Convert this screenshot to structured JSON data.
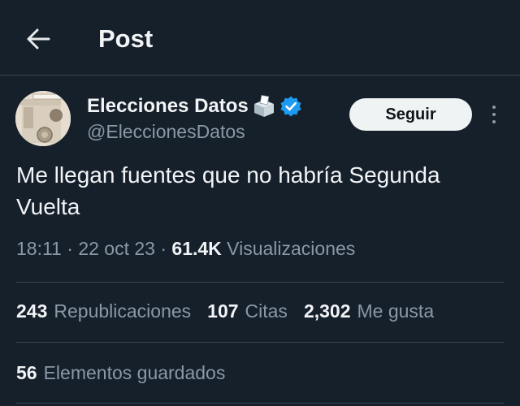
{
  "header": {
    "title": "Post",
    "back_icon": "arrow-left-icon"
  },
  "author": {
    "display_name": "Elecciones Datos",
    "name_emoji": "ballot-box-icon",
    "verified_icon": "verified-badge-icon",
    "handle": "@EleccionesDatos",
    "follow_label": "Seguir",
    "more_icon": "more-vertical-icon"
  },
  "tweet": {
    "text_line1": "Me llegan fuentes que no habría Segunda",
    "text_line2": "Vuelta"
  },
  "meta": {
    "time": "18:11",
    "separator": "·",
    "date": "22 oct 23",
    "views_count": "61.4K",
    "views_label": "Visualizaciones"
  },
  "stats": {
    "reposts_count": "243",
    "reposts_label": "Republicaciones",
    "quotes_count": "107",
    "quotes_label": "Citas",
    "likes_count": "2,302",
    "likes_label": "Me gusta",
    "bookmarks_count": "56",
    "bookmarks_label": "Elementos guardados"
  },
  "colors": {
    "background": "#15202b",
    "divider": "#38444d",
    "secondary_text": "#8b98a5",
    "primary_text": "#f2f4f5",
    "verified": "#1d9bf0",
    "follow_button_bg": "#eff3f4"
  }
}
